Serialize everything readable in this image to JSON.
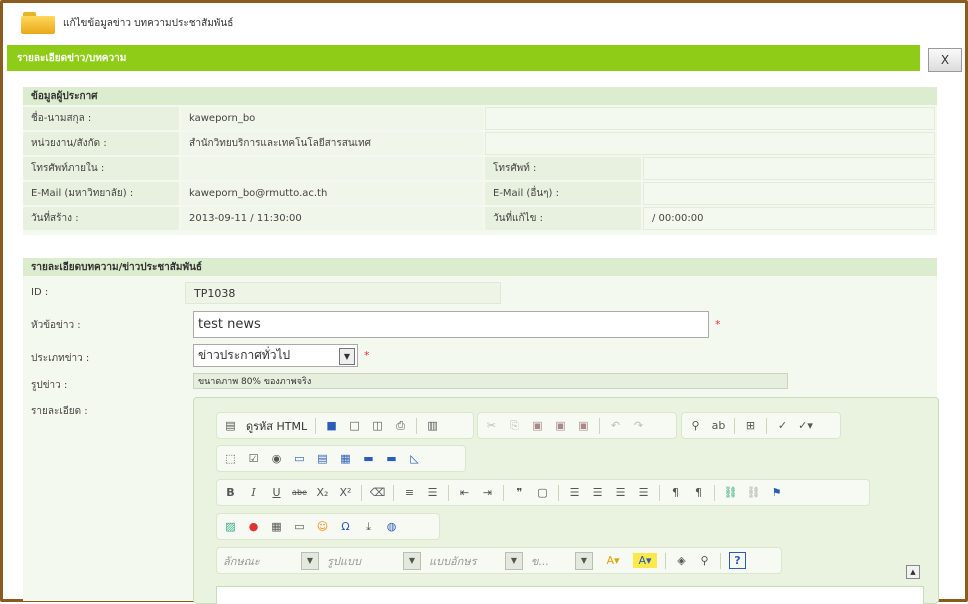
{
  "window": {
    "title": "แก้ไขข้อมูลข่าว บทความประชาสัมพันธ์"
  },
  "header": {
    "title": "รายละเอียดข่าว/บทความ",
    "close_label": "X"
  },
  "publisher": {
    "section_title": "ข้อมูลผู้ประกาศ",
    "rows": [
      {
        "label": "ชื่อ-นามสกุล :",
        "value": "kaweporn_bo"
      },
      {
        "label": "หน่วยงาน/สังกัด :",
        "value": "สำนักวิทยบริการและเทคโนโลยีสารสนเทศ"
      },
      {
        "label": "โทรศัพท์ภายใน :",
        "value": "",
        "label2": "โทรศัพท์ :",
        "value2": ""
      },
      {
        "label": "E-Mail (มหาวิทยาลัย) :",
        "value": "kaweporn_bo@rmutto.ac.th",
        "label2": "E-Mail (อื่นๆ) :",
        "value2": ""
      },
      {
        "label": "วันที่สร้าง :",
        "value": "2013-09-11 / 11:30:00",
        "label2": "วันที่แก้ไข :",
        "value2": "/ 00:00:00"
      }
    ]
  },
  "article": {
    "section_title": "รายละเอียดบทความ/ข่าวประชาสัมพันธ์",
    "id_label": "ID :",
    "id_value": "TP1038",
    "topic_label": "หัวข้อข่าว :",
    "topic_value": "test news",
    "type_label": "ประเภทข่าว :",
    "type_value": "ข่าวประกาศทั่วไป",
    "image_label": "รูปข่าว :",
    "image_note": "ขนาดภาพ 80% ของภาพจริง",
    "detail_label": "รายละเอียด :",
    "required_mark": "*"
  },
  "editor": {
    "source_label": "ดูรหัส HTML",
    "style_placeholder": "ลักษณะ",
    "format_placeholder": "รูปแบบ",
    "font_placeholder": "แบบอักษร",
    "size_placeholder": "ข...",
    "bold": "B",
    "italic": "I",
    "underline": "U",
    "strike": "abe",
    "sub": "X₂",
    "sup": "X²",
    "help": "?"
  },
  "colors": {
    "accent": "#8fcc18",
    "border": "#8a5a1e",
    "panel": "#f4f9ef"
  }
}
